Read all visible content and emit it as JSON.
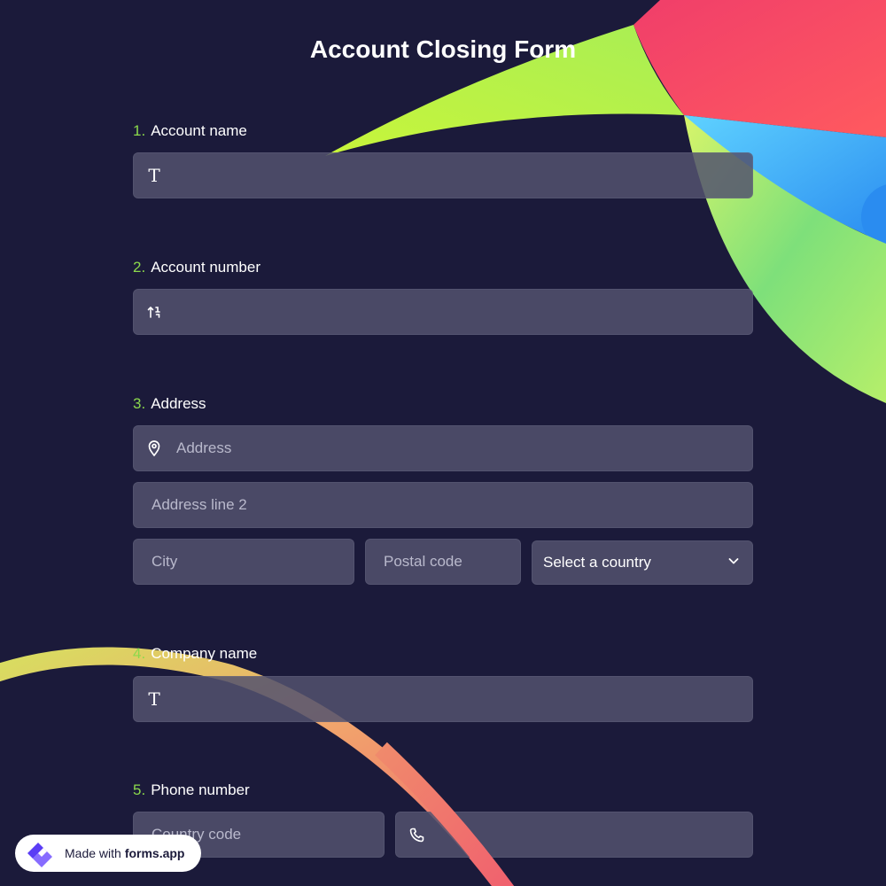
{
  "title": "Account Closing Form",
  "questions": [
    {
      "num": "1.",
      "label": "Account name"
    },
    {
      "num": "2.",
      "label": "Account number"
    },
    {
      "num": "3.",
      "label": "Address"
    },
    {
      "num": "4.",
      "label": "Company name"
    },
    {
      "num": "5.",
      "label": "Phone number"
    }
  ],
  "address": {
    "line1_placeholder": "Address",
    "line2_placeholder": "Address line 2",
    "city_placeholder": "City",
    "postal_placeholder": "Postal code",
    "country_select": "Select a country"
  },
  "phone": {
    "country_code_placeholder": "Country code"
  },
  "icons": {
    "text": "T",
    "number": "number-icon",
    "location": "map-pin-icon",
    "phone": "phone-icon",
    "chevron": "chevron-down-icon"
  },
  "badge": {
    "prefix": "Made with",
    "brand": "forms.app"
  },
  "colors": {
    "background": "#1b1a3a",
    "field": "#52526e",
    "accent_number": "#8bd94c"
  }
}
